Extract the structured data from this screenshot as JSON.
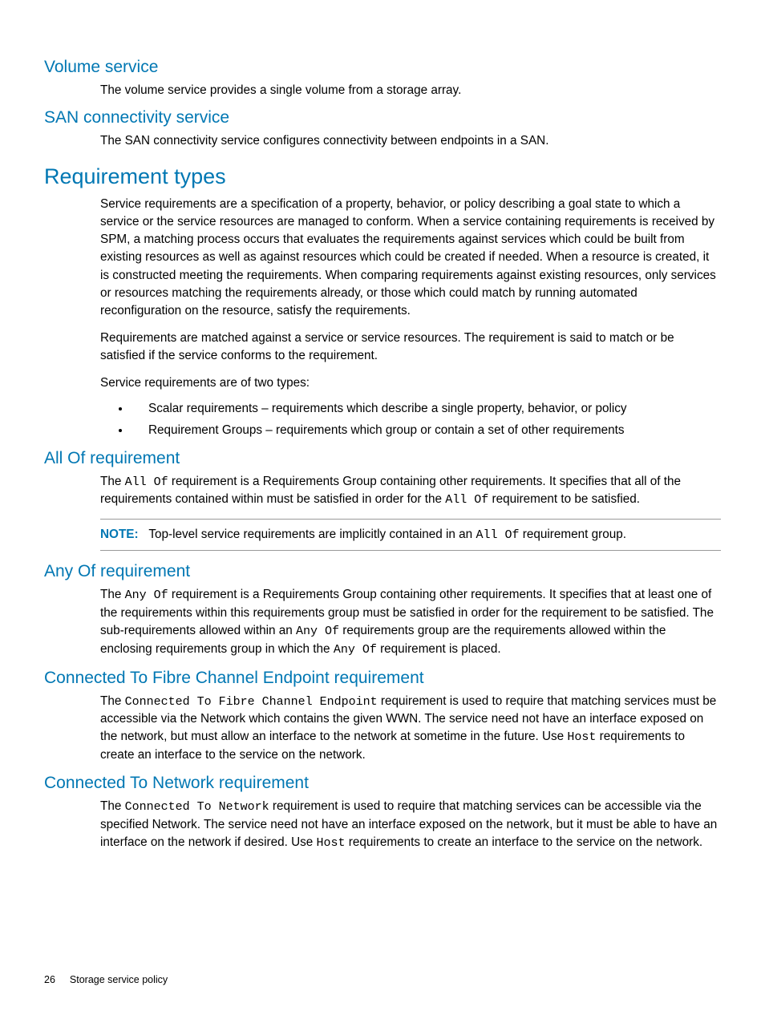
{
  "sections": {
    "volume_service": {
      "heading": "Volume service",
      "body": "The volume service provides a single volume from a storage array."
    },
    "san_connectivity": {
      "heading": "SAN connectivity service",
      "body": "The SAN connectivity service configures connectivity between endpoints in a SAN."
    },
    "requirement_types": {
      "heading": "Requirement types",
      "p1": "Service requirements are a specification of a property, behavior, or policy describing a goal state to which a service or the service resources are managed to conform. When a service containing requirements is received by SPM, a matching process occurs that evaluates the requirements against services which could be built from existing resources as well as against resources which could be created if needed. When a resource is created, it is constructed meeting the requirements. When comparing requirements against existing resources, only services or resources matching the requirements already, or those which could match by running automated reconfiguration on the resource, satisfy the requirements.",
      "p2": "Requirements are matched against a service or service resources. The requirement is said to match or be satisfied if the service conforms to the requirement.",
      "p3": "Service requirements are of two types:",
      "bullets": [
        "Scalar requirements – requirements which describe a single property, behavior, or policy",
        "Requirement Groups – requirements which group or contain a set of other requirements"
      ]
    },
    "all_of": {
      "heading": "All Of requirement",
      "p1_pre": "The ",
      "p1_code1": "All Of",
      "p1_mid": " requirement is a Requirements Group containing other requirements. It specifies that all of the requirements contained within must be satisfied in order for the ",
      "p1_code2": "All Of",
      "p1_post": " requirement to be satisfied.",
      "note_label": "NOTE:",
      "note_pre": "Top-level service requirements are implicitly contained in an ",
      "note_code": "All Of",
      "note_post": " requirement group."
    },
    "any_of": {
      "heading": "Any Of requirement",
      "p1_pre": "The ",
      "p1_code1": "Any Of",
      "p1_mid1": " requirement is a Requirements Group containing other requirements. It specifies that at least one of the requirements within this requirements group must be satisfied in order for the requirement to be satisfied. The sub-requirements allowed within an ",
      "p1_code2": "Any Of",
      "p1_mid2": " requirements group are the requirements allowed within the enclosing requirements group in which the ",
      "p1_code3": "Any Of",
      "p1_post": " requirement is placed."
    },
    "fc_endpoint": {
      "heading": "Connected To Fibre Channel Endpoint requirement",
      "p1_pre": "The ",
      "p1_code1": "Connected To Fibre Channel Endpoint",
      "p1_mid": " requirement is used to require that matching services must be accessible via the Network which contains the given WWN. The service need not have an interface exposed on the network, but must allow an interface to the network at sometime in the future. Use ",
      "p1_code2": "Host",
      "p1_post": " requirements to create an interface to the service on the network."
    },
    "connected_network": {
      "heading": "Connected To Network requirement",
      "p1_pre": "The ",
      "p1_code1": "Connected To Network",
      "p1_mid": " requirement is used to require that matching services can be accessible via the specified Network. The service need not have an interface exposed on the network, but it must be able to have an interface on the network if desired. Use ",
      "p1_code2": "Host",
      "p1_post": " requirements to create an interface to the service on the network."
    }
  },
  "footer": {
    "page_number": "26",
    "chapter": "Storage service policy"
  }
}
